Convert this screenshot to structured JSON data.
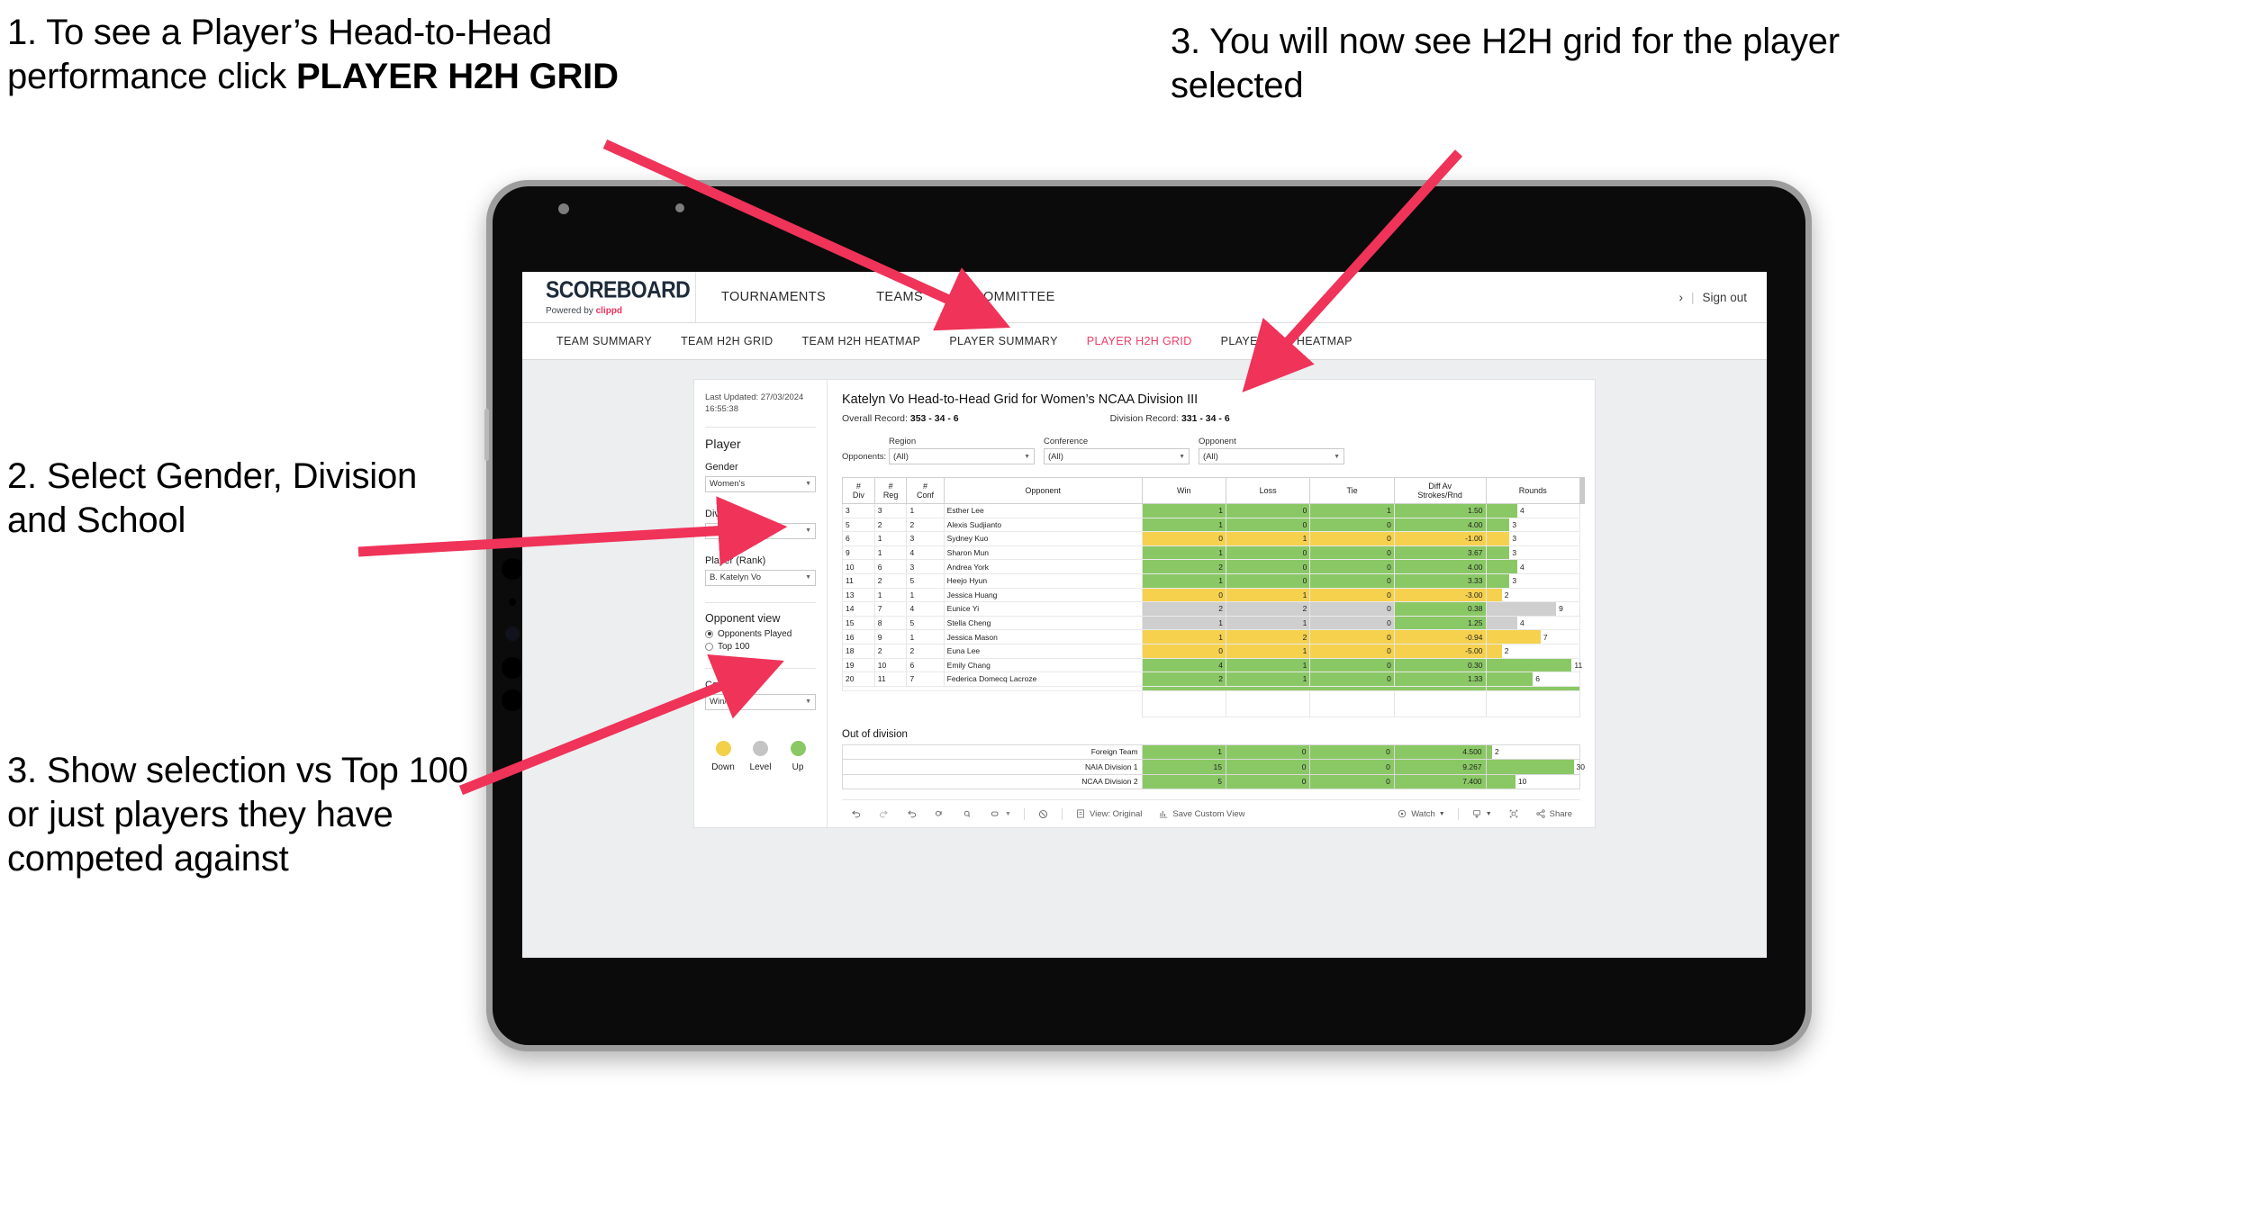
{
  "annotations": [
    {
      "id": "a1",
      "text_before": "1. To see a Player’s Head-to-Head performance click ",
      "bold": "PLAYER H2H GRID"
    },
    {
      "id": "a2",
      "text": "2. Select Gender, Division and School"
    },
    {
      "id": "a3",
      "text": "3. Show selection vs Top 100 or just players they have competed against"
    },
    {
      "id": "a4",
      "text": "3. You will now see H2H grid for the player selected"
    }
  ],
  "brand": {
    "wordmark": "SCOREBOARD",
    "powered_prefix": "Powered by ",
    "powered_name": "clippd",
    "accent": "#e8335a"
  },
  "topnav": {
    "items": [
      "TOURNAMENTS",
      "TEAMS",
      "COMMITTEE"
    ],
    "signout": "Sign out",
    "separator": "|",
    "chevron": "›"
  },
  "subnav": {
    "items": [
      {
        "label": "TEAM SUMMARY",
        "active": false
      },
      {
        "label": "TEAM H2H GRID",
        "active": false
      },
      {
        "label": "TEAM H2H HEATMAP",
        "active": false
      },
      {
        "label": "PLAYER SUMMARY",
        "active": false
      },
      {
        "label": "PLAYER H2H GRID",
        "active": true
      },
      {
        "label": "PLAYER H2H HEATMAP",
        "active": false
      }
    ],
    "active_color": "#ef3d68"
  },
  "pane": {
    "last_updated": "Last Updated: 27/03/2024 16:55:38",
    "section_player": "Player",
    "gender_label": "Gender",
    "gender_value": "Women's",
    "division_label": "Division",
    "division_value": "NCAA Division III",
    "player_label": "Player (Rank)",
    "player_value": "B. Katelyn Vo",
    "opponent_view_label": "Opponent view",
    "radio_played": "Opponents Played",
    "radio_top100": "Top 100",
    "radio_selected": "Opponents Played",
    "colour_by_label": "Colour by",
    "colour_by_value": "Win/loss",
    "legend": [
      {
        "label": "Down",
        "color": "#f3d04a"
      },
      {
        "label": "Level",
        "color": "#c4c4c4"
      },
      {
        "label": "Up",
        "color": "#8ac865"
      }
    ]
  },
  "viz": {
    "title": "Katelyn Vo Head-to-Head Grid for Women’s NCAA Division III",
    "overall_record_label": "Overall Record:",
    "overall_record_value": "353 -  34 - 6",
    "division_record_label": "Division Record:",
    "division_record_value": "331 -  34 - 6",
    "opponents_label": "Opponents:",
    "filters": [
      {
        "label": "Region",
        "value": "(All)"
      },
      {
        "label": "Conference",
        "value": "(All)"
      },
      {
        "label": "Opponent",
        "value": "(All)"
      }
    ],
    "out_of_division_label": "Out of division"
  },
  "chart_data": {
    "type": "table",
    "title": "Katelyn Vo Head-to-Head Grid for Women’s NCAA Division III",
    "columns": [
      "# Div",
      "# Reg",
      "# Conf",
      "Opponent",
      "Win",
      "Loss",
      "Tie",
      "Diff Av Strokes/Rnd",
      "Rounds"
    ],
    "column_headers_two_line": [
      [
        "#",
        "Div"
      ],
      [
        "#",
        "Reg"
      ],
      [
        "#",
        "Conf"
      ],
      [
        "Opponent",
        ""
      ],
      [
        "Win",
        ""
      ],
      [
        "Loss",
        ""
      ],
      [
        "Tie",
        ""
      ],
      [
        "Diff Av",
        "Strokes/Rnd"
      ],
      [
        "Rounds",
        ""
      ]
    ],
    "rounds_max": 12,
    "rows": [
      {
        "div": "3",
        "reg": "3",
        "conf": "1",
        "opponent": "Esther Lee",
        "win": "1",
        "loss": "0",
        "tie": "1",
        "diff": "1.50",
        "rounds": 4,
        "state": "up"
      },
      {
        "div": "5",
        "reg": "2",
        "conf": "2",
        "opponent": "Alexis Sudjianto",
        "win": "1",
        "loss": "0",
        "tie": "0",
        "diff": "4.00",
        "rounds": 3,
        "state": "up"
      },
      {
        "div": "6",
        "reg": "1",
        "conf": "3",
        "opponent": "Sydney Kuo",
        "win": "0",
        "loss": "1",
        "tie": "0",
        "diff": "-1.00",
        "rounds": 3,
        "state": "down"
      },
      {
        "div": "9",
        "reg": "1",
        "conf": "4",
        "opponent": "Sharon Mun",
        "win": "1",
        "loss": "0",
        "tie": "0",
        "diff": "3.67",
        "rounds": 3,
        "state": "up"
      },
      {
        "div": "10",
        "reg": "6",
        "conf": "3",
        "opponent": "Andrea York",
        "win": "2",
        "loss": "0",
        "tie": "0",
        "diff": "4.00",
        "rounds": 4,
        "state": "up"
      },
      {
        "div": "11",
        "reg": "2",
        "conf": "5",
        "opponent": "Heejo Hyun",
        "win": "1",
        "loss": "0",
        "tie": "0",
        "diff": "3.33",
        "rounds": 3,
        "state": "up"
      },
      {
        "div": "13",
        "reg": "1",
        "conf": "1",
        "opponent": "Jessica Huang",
        "win": "0",
        "loss": "1",
        "tie": "0",
        "diff": "-3.00",
        "rounds": 2,
        "state": "down"
      },
      {
        "div": "14",
        "reg": "7",
        "conf": "4",
        "opponent": "Eunice Yi",
        "win": "2",
        "loss": "2",
        "tie": "0",
        "diff": "0.38",
        "rounds": 9,
        "state": "level",
        "diff_state": "up"
      },
      {
        "div": "15",
        "reg": "8",
        "conf": "5",
        "opponent": "Stella Cheng",
        "win": "1",
        "loss": "1",
        "tie": "0",
        "diff": "1.25",
        "rounds": 4,
        "state": "level",
        "diff_state": "up"
      },
      {
        "div": "16",
        "reg": "9",
        "conf": "1",
        "opponent": "Jessica Mason",
        "win": "1",
        "loss": "2",
        "tie": "0",
        "diff": "-0.94",
        "rounds": 7,
        "state": "down"
      },
      {
        "div": "18",
        "reg": "2",
        "conf": "2",
        "opponent": "Euna Lee",
        "win": "0",
        "loss": "1",
        "tie": "0",
        "diff": "-5.00",
        "rounds": 2,
        "state": "down"
      },
      {
        "div": "19",
        "reg": "10",
        "conf": "6",
        "opponent": "Emily Chang",
        "win": "4",
        "loss": "1",
        "tie": "0",
        "diff": "0.30",
        "rounds": 11,
        "state": "up"
      },
      {
        "div": "20",
        "reg": "11",
        "conf": "7",
        "opponent": "Federica Domecq Lacroze",
        "win": "2",
        "loss": "1",
        "tie": "0",
        "diff": "1.33",
        "rounds": 6,
        "state": "up"
      }
    ],
    "out_of_division": {
      "rounds_max": 32,
      "rows": [
        {
          "name": "Foreign Team",
          "win": "1",
          "loss": "0",
          "tie": "0",
          "diff": "4.500",
          "rounds": 2,
          "state": "up"
        },
        {
          "name": "NAIA Division 1",
          "win": "15",
          "loss": "0",
          "tie": "0",
          "diff": "9.267",
          "rounds": 30,
          "state": "up"
        },
        {
          "name": "NCAA Division 2",
          "win": "5",
          "loss": "0",
          "tie": "0",
          "diff": "7.400",
          "rounds": 10,
          "state": "up"
        }
      ]
    },
    "colors": {
      "up": "#8ac865",
      "down": "#f5d14e",
      "level": "#cfcfcf"
    }
  },
  "toolbar": {
    "view_original": "View: Original",
    "save_custom_view": "Save Custom View",
    "watch": "Watch",
    "share": "Share",
    "caret": "▾"
  }
}
